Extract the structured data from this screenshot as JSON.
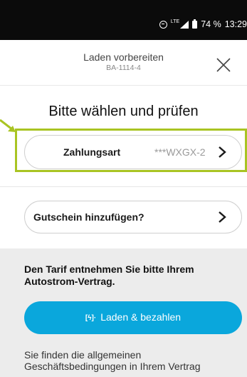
{
  "status_bar": {
    "network": "LTE",
    "battery": "74 %",
    "time": "13:29"
  },
  "header": {
    "title": "Laden vorbereiten",
    "subtitle": "BA-1114-4"
  },
  "main": {
    "heading": "Bitte wählen und prüfen",
    "payment": {
      "label": "Zahlungsart",
      "value": "***WXGX-2"
    },
    "voucher": {
      "label": "Gutschein hinzufügen?"
    },
    "tariff_note": "Den Tarif entnehmen Sie bitte Ihrem Autostrom-Vertrag.",
    "pay_button": {
      "icon": "[ϟ]·",
      "label": "Laden & bezahlen"
    },
    "terms": "Sie finden die allgemeinen Geschäftsbedingungen in Ihrem Vertrag"
  },
  "colors": {
    "highlight": "#a9c423",
    "primary_button": "#0aa7dc",
    "status_bar": "#0b0b0b",
    "bottom_panel": "#ececec"
  }
}
